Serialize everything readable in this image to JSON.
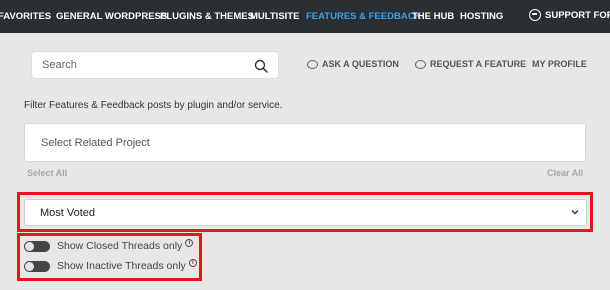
{
  "nav": {
    "items": [
      "FAVORITES",
      "GENERAL WORDPRESS",
      "PLUGINS & THEMES",
      "MULTISITE",
      "FEATURES & FEEDBACK",
      "THE HUB",
      "HOSTING"
    ],
    "active_index": 4,
    "support_label": "SUPPORT FORU",
    "active_color": "#3fa0e6"
  },
  "search": {
    "placeholder": "Search"
  },
  "links": {
    "ask": "ASK A QUESTION",
    "request": "REQUEST A FEATURE",
    "profile": "MY PROFILE"
  },
  "filter": {
    "label": "Filter Features & Feedback posts by plugin and/or service.",
    "project_placeholder": "Select Related Project",
    "select_all": "Select All",
    "clear_all": "Clear All"
  },
  "sort": {
    "selected": "Most Voted"
  },
  "toggles": [
    {
      "label": "Show Closed Threads only",
      "on": false
    },
    {
      "label": "Show Inactive Threads only",
      "on": false
    }
  ],
  "highlight_color": "#e3151d"
}
